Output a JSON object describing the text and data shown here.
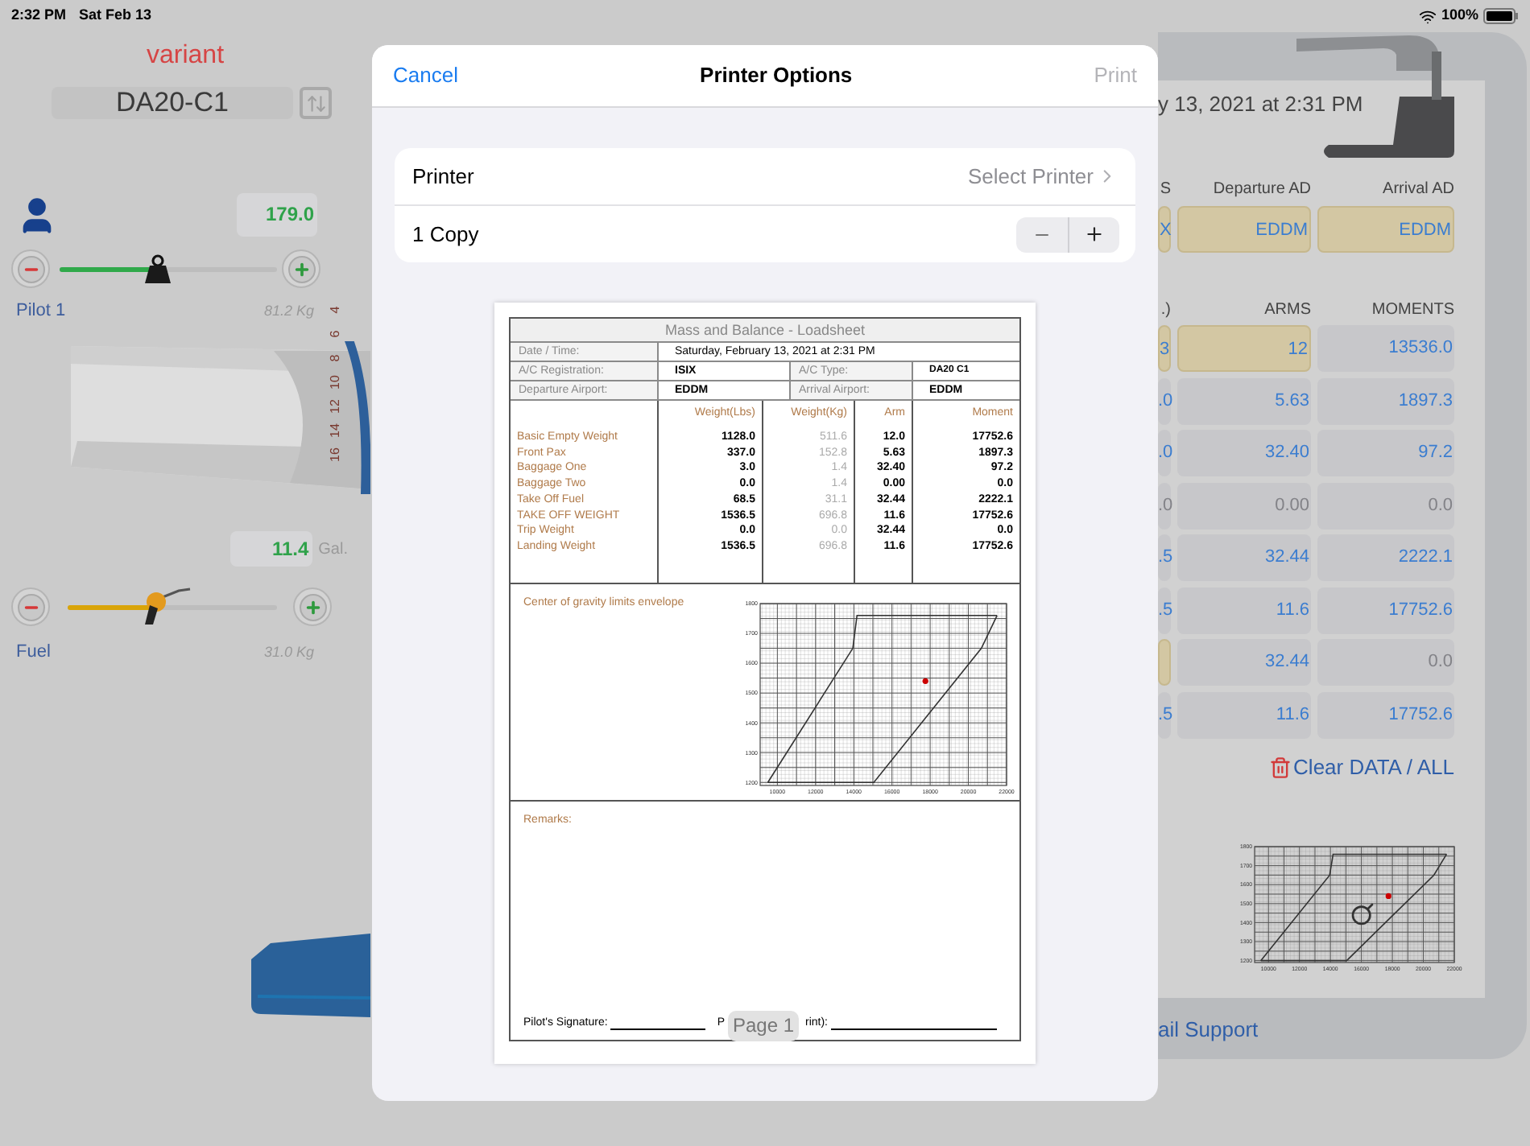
{
  "status_bar": {
    "time": "2:32 PM",
    "date": "Sat Feb 13",
    "battery": "100%"
  },
  "left_panel": {
    "variant_label": "variant",
    "variant": "DA20-C1",
    "pilot": {
      "value": "179.0",
      "level": 0.45,
      "name": "Pilot 1",
      "kg": "81.2 Kg"
    },
    "ruler": [
      "4",
      "6",
      "8",
      "10",
      "12",
      "14",
      "16"
    ],
    "fuel": {
      "value": "11.4",
      "unit": "Gal.",
      "level": 0.43,
      "name": "Fuel",
      "kg": "31.0 Kg"
    }
  },
  "right_panel": {
    "date": "y 13, 2021 at 2:31 PM",
    "airport_headers": [
      "S",
      "Departure AD",
      "Arrival AD"
    ],
    "airport_cells": [
      {
        "text": "X",
        "kind": "input",
        "muted": false
      },
      {
        "text": "EDDM",
        "kind": "input",
        "muted": false
      },
      {
        "text": "EDDM",
        "kind": "input",
        "muted": false
      }
    ],
    "column_headers": [
      ".)",
      "ARMS",
      "MOMENTS"
    ],
    "rows": [
      [
        {
          "text": "3",
          "kind": "input",
          "muted": false
        },
        {
          "text": "12",
          "kind": "input",
          "muted": false
        },
        {
          "text": "13536.0",
          "kind": "output",
          "muted": false
        }
      ],
      [
        {
          "text": ".0",
          "kind": "output",
          "muted": false
        },
        {
          "text": "5.63",
          "kind": "output",
          "muted": false
        },
        {
          "text": "1897.3",
          "kind": "output",
          "muted": false
        }
      ],
      [
        {
          "text": ".0",
          "kind": "output",
          "muted": false
        },
        {
          "text": "32.40",
          "kind": "output",
          "muted": false
        },
        {
          "text": "97.2",
          "kind": "output",
          "muted": false
        }
      ],
      [
        {
          "text": ".0",
          "kind": "output",
          "muted": true
        },
        {
          "text": "0.00",
          "kind": "output",
          "muted": true
        },
        {
          "text": "0.0",
          "kind": "output",
          "muted": true
        }
      ],
      [
        {
          "text": ".5",
          "kind": "output",
          "muted": false
        },
        {
          "text": "32.44",
          "kind": "output",
          "muted": false
        },
        {
          "text": "2222.1",
          "kind": "output",
          "muted": false
        }
      ],
      [
        {
          "text": ".5",
          "kind": "output",
          "muted": false
        },
        {
          "text": "11.6",
          "kind": "output",
          "muted": false
        },
        {
          "text": "17752.6",
          "kind": "output",
          "muted": false
        }
      ],
      [
        {
          "kind": "input"
        },
        {
          "text": "32.44",
          "kind": "output",
          "muted": false
        },
        {
          "text": "0.0",
          "kind": "output",
          "muted": true
        }
      ],
      [
        {
          "text": ".5",
          "kind": "output",
          "muted": false
        },
        {
          "text": "11.6",
          "kind": "output",
          "muted": false
        },
        {
          "text": "17752.6",
          "kind": "output",
          "muted": false
        }
      ]
    ],
    "clear_button": "Clear DATA / ALL",
    "chart_data": {
      "type": "line",
      "x": [
        9500,
        13950,
        14170,
        15050,
        17750,
        20680,
        21500
      ],
      "series": [
        {
          "color": "#333333",
          "marker": false,
          "values": [
            1200,
            1650,
            1760,
            1760,
            1760,
            1760,
            1760
          ]
        },
        {
          "color": "#333333",
          "marker": false,
          "values": [
            1200,
            1200,
            1200,
            1200,
            1416,
            1650,
            1760
          ]
        },
        {
          "color": "#cc0000",
          "marker": true,
          "values": [
            null,
            null,
            null,
            null,
            1540,
            null,
            null
          ]
        }
      ],
      "grid": true,
      "xlim": [
        9100,
        22000
      ],
      "ylim": [
        1190,
        1800
      ],
      "xticks": [
        10000,
        12000,
        14000,
        16000,
        18000,
        20000,
        22000
      ],
      "yticks": [
        1200,
        1300,
        1400,
        1500,
        1600,
        1700,
        1800
      ]
    },
    "support_link": "ail Support"
  },
  "dialog": {
    "cancel": "Cancel",
    "title": "Printer Options",
    "print": {
      "label": "Print",
      "disabled": true
    },
    "printer": {
      "label": "Printer",
      "value": "Select Printer"
    },
    "copies": {
      "label": "1 Copy"
    },
    "page_badge": "Page 1",
    "loadsheet": {
      "title": "Mass and Balance - Loadsheet",
      "info": {
        "date_label": "Date / Time:",
        "date": "Saturday, February 13, 2021 at 2:31 PM",
        "registration_label": "A/C Registration:",
        "registration": "ISIX",
        "type_label": "A/C Type:",
        "type": "DA20 C1",
        "departure_label": "Departure Airport:",
        "departure": "EDDM",
        "arrival_label": "Arrival Airport:",
        "arrival": "EDDM"
      },
      "columns": [
        "Weight(Lbs)",
        "Weight(Kg)",
        "Arm",
        "Moment"
      ],
      "rows": [
        {
          "label": "Basic Empty Weight",
          "values": [
            "1128.0",
            "511.6",
            "12.0",
            "17752.6"
          ]
        },
        {
          "label": "Front Pax",
          "values": [
            "337.0",
            "152.8",
            "5.63",
            "1897.3"
          ]
        },
        {
          "label": "Baggage One",
          "values": [
            "3.0",
            "1.4",
            "32.40",
            "97.2"
          ]
        },
        {
          "label": "Baggage Two",
          "values": [
            "0.0",
            "1.4",
            "0.00",
            "0.0"
          ]
        },
        {
          "label": "Take Off Fuel",
          "values": [
            "68.5",
            "31.1",
            "32.44",
            "2222.1"
          ]
        },
        {
          "label": "TAKE OFF WEIGHT",
          "values": [
            "1536.5",
            "696.8",
            "11.6",
            "17752.6"
          ]
        },
        {
          "label": "Trip Weight",
          "values": [
            "0.0",
            "0.0",
            "32.44",
            "0.0"
          ]
        },
        {
          "label": "Landing Weight",
          "values": [
            "1536.5",
            "696.8",
            "11.6",
            "17752.6"
          ]
        }
      ],
      "chart_title": "Center of gravity limits envelope",
      "chart_data": {
        "type": "line",
        "x": [
          9500,
          13950,
          14170,
          15050,
          17750,
          20680,
          21500
        ],
        "series": [
          {
            "color": "#333333",
            "marker": false,
            "values": [
              1200,
              1650,
              1760,
              1760,
              1760,
              1760,
              1760
            ]
          },
          {
            "color": "#333333",
            "marker": false,
            "values": [
              1200,
              1200,
              1200,
              1200,
              1416,
              1650,
              1760
            ]
          },
          {
            "color": "#cc0000",
            "marker": true,
            "values": [
              null,
              null,
              null,
              null,
              1540,
              null,
              null
            ]
          }
        ],
        "grid": true,
        "xlim": [
          9100,
          22000
        ],
        "ylim": [
          1190,
          1800
        ],
        "xticks": [
          10000,
          12000,
          14000,
          16000,
          18000,
          20000,
          22000
        ],
        "yticks": [
          1200,
          1300,
          1400,
          1500,
          1600,
          1700,
          1800
        ]
      },
      "remarks_label": "Remarks:",
      "signature_label": "Pilot's Signature:",
      "name_label_start": "P",
      "name_label_end": "rint):"
    }
  }
}
